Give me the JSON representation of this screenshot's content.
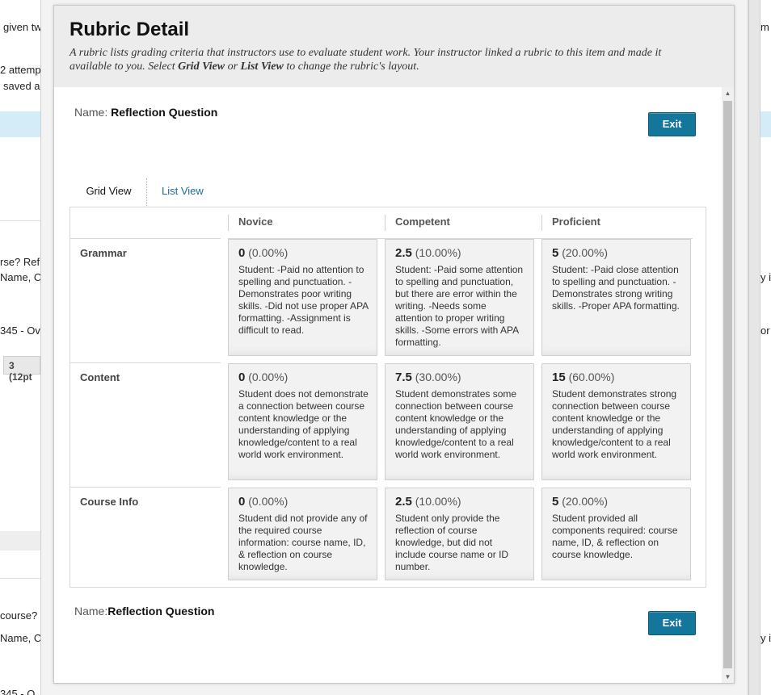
{
  "background_page": {
    "fragments": [
      "given tw",
      "2 attemp",
      "saved a",
      "rse? Ref",
      "Name, C",
      "345 - Ove",
      "3 (12pt",
      "course?",
      "Name, C",
      "345 - O",
      "m",
      "y i",
      "or",
      "y i"
    ]
  },
  "dialog": {
    "title": "Rubric Detail",
    "desc_part1": "A rubric lists grading criteria that instructors use to evaluate student work. Your instructor linked a rubric to this item and made it available to you. Select ",
    "desc_bold1": "Grid View",
    "desc_part2": " or ",
    "desc_bold2": "List View",
    "desc_part3": " to change the rubric's layout.",
    "name_label_top": "Name:",
    "name_label_bottom": "Name:",
    "rubric_name": "Reflection Question",
    "exit_label": "Exit",
    "tabs": {
      "grid": "Grid View",
      "list": "List View"
    },
    "columns": [
      "Novice",
      "Competent",
      "Proficient"
    ],
    "rows": [
      {
        "label": "Grammar",
        "cells": [
          {
            "points": "0",
            "pct": "(0.00%)",
            "desc": "Student: -Paid no attention to spelling and punctuation. -Demonstrates poor writing skills. -Did not use proper APA formatting. -Assignment is difficult to read."
          },
          {
            "points": "2.5",
            "pct": "(10.00%)",
            "desc": "Student: -Paid some attention to spelling and punctuation, but there are error within the writing. -Needs some attention to proper writing skills. -Some errors with APA formatting."
          },
          {
            "points": "5",
            "pct": "(20.00%)",
            "desc": "Student: -Paid close attention to spelling and punctuation. -Demonstrates strong writing skills. -Proper APA formatting."
          }
        ]
      },
      {
        "label": "Content",
        "cells": [
          {
            "points": "0",
            "pct": "(0.00%)",
            "desc": "Student does not demonstrate a connection between course content knowledge or the understanding of applying knowledge/content to a real world work environment."
          },
          {
            "points": "7.5",
            "pct": "(30.00%)",
            "desc": "Student demonstrates some connection between course content knowledge or the understanding of applying knowledge/content to a real world work environment."
          },
          {
            "points": "15",
            "pct": "(60.00%)",
            "desc": "Student demonstrates strong connection between course content knowledge or the understanding of applying knowledge/content to a real world work environment."
          }
        ]
      },
      {
        "label": "Course Info",
        "cells": [
          {
            "points": "0",
            "pct": "(0.00%)",
            "desc": "Student did not provide any of the required course information: course name, ID, & reflection on course knowledge."
          },
          {
            "points": "2.5",
            "pct": "(10.00%)",
            "desc": "Student only provide the reflection of course knowledge, but did not include course name or ID number."
          },
          {
            "points": "5",
            "pct": "(20.00%)",
            "desc": "Student provided all components required: course name, ID, & reflection on course knowledge."
          }
        ]
      }
    ]
  },
  "colors": {
    "exit_button": "#14769a",
    "link": "#1a6a94",
    "cell_bg": "#f2f2f2"
  }
}
